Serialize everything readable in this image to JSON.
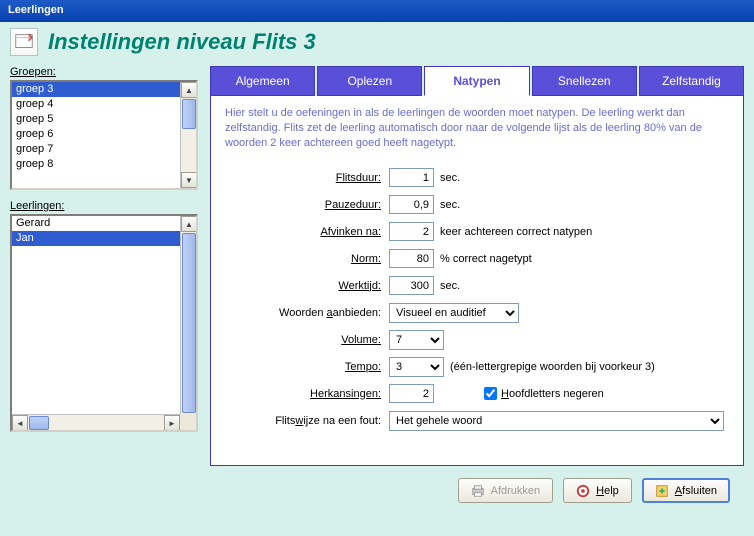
{
  "window": {
    "title": "Leerlingen"
  },
  "header": {
    "title": "Instellingen niveau Flits 3"
  },
  "left": {
    "groups_label": "Groepen:",
    "students_label": "Leerlingen:",
    "groups": [
      "groep 3",
      "groep 4",
      "groep 5",
      "groep 6",
      "groep 7",
      "groep 8"
    ],
    "groups_selected": 0,
    "students": [
      "Gerard",
      "Jan"
    ],
    "students_selected": 1
  },
  "tabs": {
    "items": [
      "Algemeen",
      "Oplezen",
      "Natypen",
      "Snellezen",
      "Zelfstandig"
    ],
    "active": 2
  },
  "panel": {
    "description": "Hier stelt u de oefeningen in als de leerlingen de woorden moet natypen. De leerling werkt dan zelfstandig. Flits zet de leerling automatisch door naar de volgende lijst als de leerling 80% van de woorden 2 keer achtereen goed heeft nagetypt."
  },
  "form": {
    "flitsduur": {
      "label": "Flitsduur:",
      "value": "1",
      "suffix": "sec.",
      "u": "F"
    },
    "pauzeduur": {
      "label": "Pauzeduur:",
      "value": "0,9",
      "suffix": "sec.",
      "u": "P"
    },
    "afvinken": {
      "label": "Afvinken na:",
      "value": "2",
      "suffix": "keer achtereen correct natypen",
      "u": "A"
    },
    "norm": {
      "label": "Norm:",
      "value": "80",
      "suffix": "% correct nagetypt",
      "u": "N"
    },
    "werktijd": {
      "label": "Werktijd:",
      "value": "300",
      "suffix": "sec.",
      "u": "W"
    },
    "aanbieden": {
      "label": "Woorden aanbieden:",
      "value": "Visueel en auditief",
      "u": "a"
    },
    "volume": {
      "label": "Volume:",
      "value": "7",
      "u": "V"
    },
    "tempo": {
      "label": "Tempo:",
      "value": "3",
      "suffix": "(één-lettergrepige woorden bij voorkeur 3)",
      "u": "T"
    },
    "herkansingen": {
      "label": "Herkansingen:",
      "value": "2",
      "u": "H"
    },
    "hoofdletters": {
      "label": "Hoofdletters negeren",
      "checked": true,
      "u": "H"
    },
    "flitswijze": {
      "label": "Flitswijze na een fout:",
      "value": "Het gehele woord",
      "u": "w"
    }
  },
  "buttons": {
    "print": "Afdrukken",
    "help": "Help",
    "close": "Afsluiten"
  }
}
